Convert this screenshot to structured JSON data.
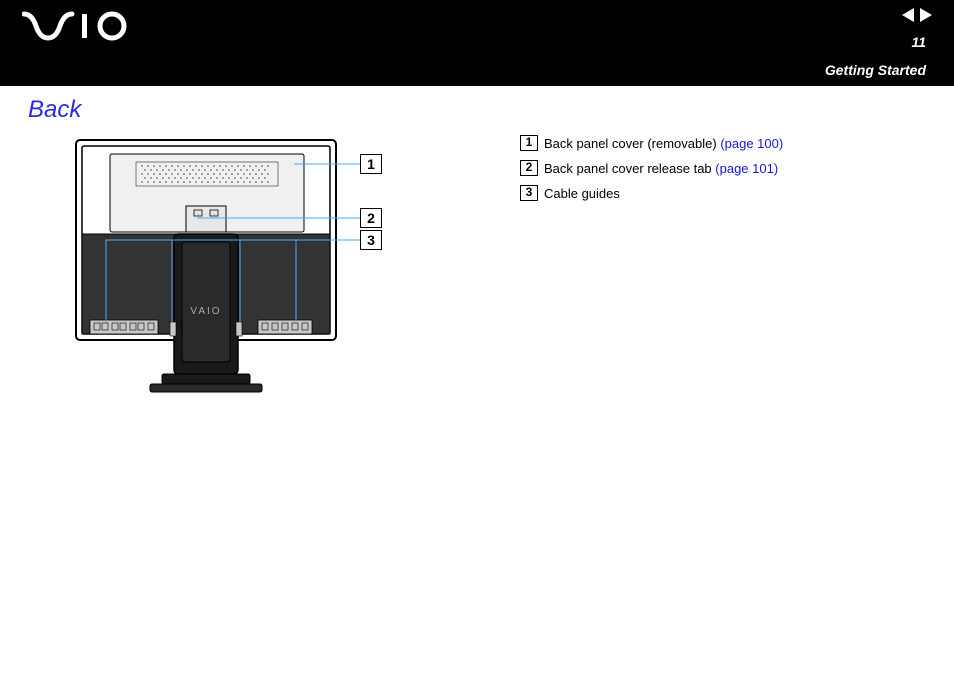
{
  "header": {
    "logo_text": "VAIO",
    "page_number": "11",
    "section": "Getting Started"
  },
  "heading": "Back",
  "callouts": {
    "c1": "1",
    "c2": "2",
    "c3": "3"
  },
  "legend": {
    "items": [
      {
        "num": "1",
        "text": "Back panel cover (removable) ",
        "link": "(page 100)"
      },
      {
        "num": "2",
        "text": "Back panel cover release tab ",
        "link": "(page 101)"
      },
      {
        "num": "3",
        "text": "Cable guides",
        "link": ""
      }
    ]
  }
}
